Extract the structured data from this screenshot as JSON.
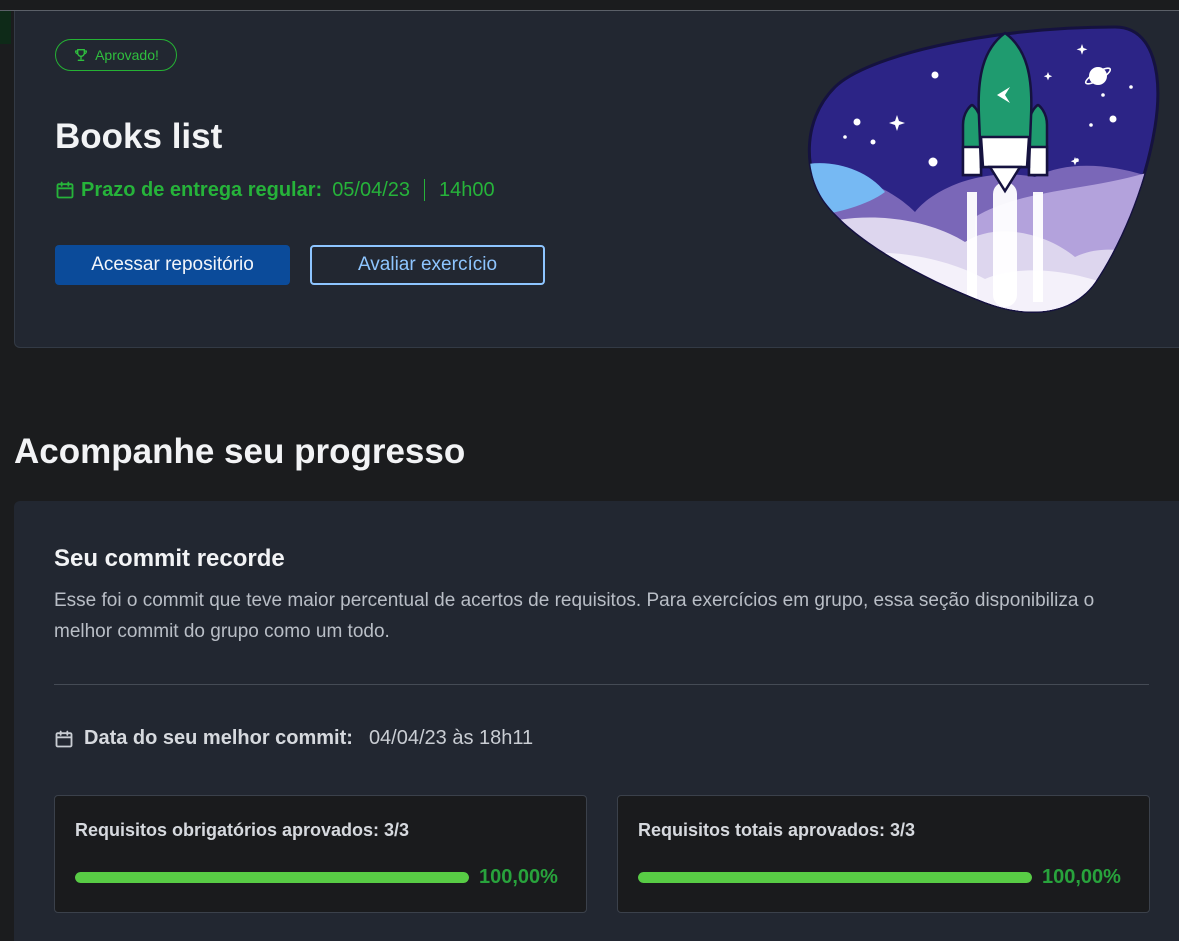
{
  "exercise": {
    "badge_label": "Aprovado!",
    "title": "Books list",
    "deadline_label": "Prazo de entrega regular:",
    "deadline_date": "05/04/23",
    "deadline_time": "14h00",
    "buttons": {
      "repo": "Acessar repositório",
      "evaluate": "Avaliar exercício"
    }
  },
  "progress": {
    "section_title": "Acompanhe seu progresso",
    "commit_title": "Seu commit recorde",
    "commit_description": "Esse foi o commit que teve maior percentual de acertos de requisitos. Para exercícios em grupo, essa seção disponibiliza o melhor commit do grupo como um todo.",
    "best_commit_label": "Data do seu melhor commit:",
    "best_commit_value": "04/04/23 às 18h11",
    "stats": [
      {
        "label": "Requisitos obrigatórios aprovados: 3/3",
        "percent_text": "100,00%",
        "fraction": 1.0
      },
      {
        "label": "Requisitos totais aprovados: 3/3",
        "percent_text": "100,00%",
        "fraction": 1.0
      }
    ]
  },
  "colors": {
    "success": "#2fbf3e",
    "primary_button": "#0b4b9a",
    "outline_button": "#8ec5ff",
    "progress_fill": "#58cc45"
  },
  "icons": [
    "trophy-icon",
    "calendar-icon",
    "rocket-illustration"
  ]
}
